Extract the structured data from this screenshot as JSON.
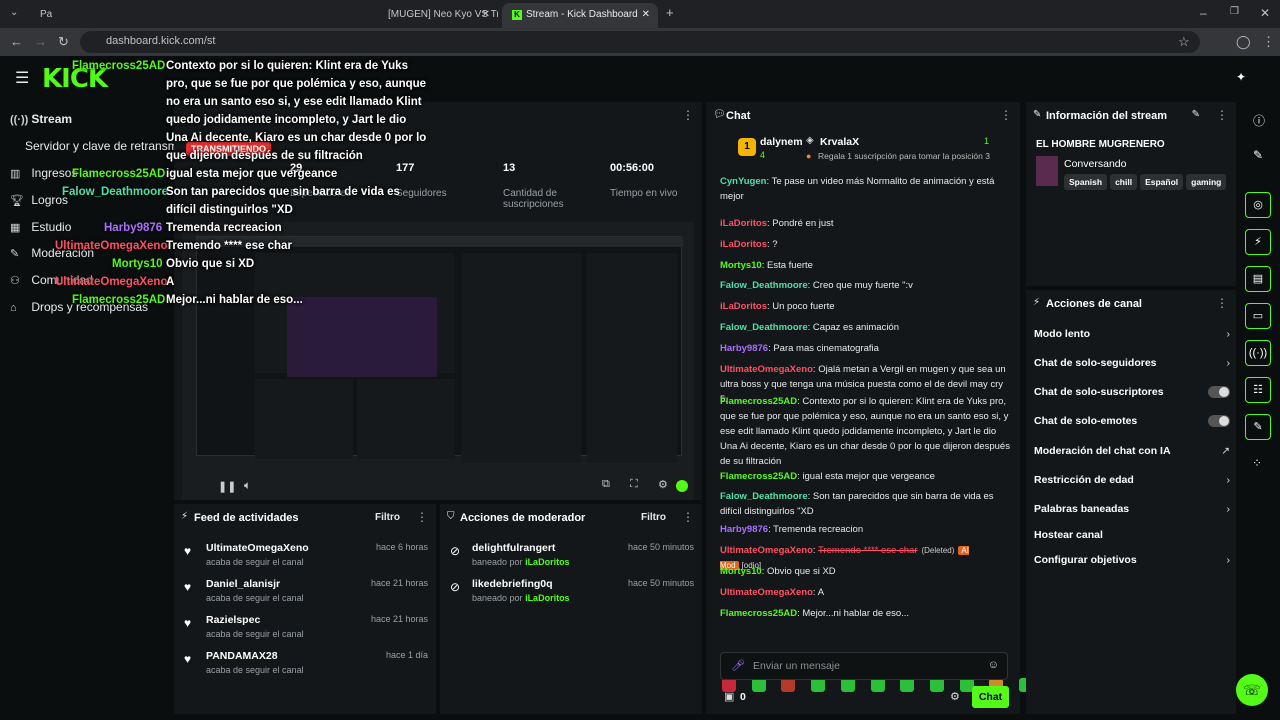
{
  "browser": {
    "tabs": [
      {
        "label": "Pa"
      },
      {
        "label": "[MUGEN] Neo Kyo VS Tru"
      },
      {
        "label": "Stream - Kick Dashboard"
      }
    ],
    "url": "dashboard.kick.com/st"
  },
  "sidebar": {
    "items": [
      {
        "label": "Stream",
        "icon": "stream-icon"
      },
      {
        "label": "Servidor y clave de retransm",
        "icon": ""
      },
      {
        "label": "Ingresos",
        "icon": "chart-icon"
      },
      {
        "label": "Logros",
        "icon": "trophy-icon"
      },
      {
        "label": "Estudio",
        "icon": "studio-icon"
      },
      {
        "label": "Moderación",
        "icon": "wrench-icon"
      },
      {
        "label": "Comunidad",
        "icon": "people-icon"
      },
      {
        "label": "Drops y recompensas",
        "icon": "gift-icon"
      }
    ]
  },
  "overlay": {
    "lines": [
      {
        "user": "UltimateOmegaXeno",
        "color": "#ff4f64",
        "text": "Ojalá metan a Vergil en mugen y que sea un"
      },
      {
        "user": "",
        "color": "",
        "text": "ultra boss y que tenga una música puesta"
      },
      {
        "user": "",
        "color": "",
        "text": "como el de devil may cry 5."
      },
      {
        "user": "Flamecross25AD",
        "color": "#53fc18",
        "text": "Contexto por si lo quieren: Klint era de Yuks"
      },
      {
        "user": "",
        "color": "",
        "text": "pro, que se fue por que polémica y eso, aunque"
      },
      {
        "user": "",
        "color": "",
        "text": "no era un santo eso si, y ese edit llamado Klint"
      },
      {
        "user": "",
        "color": "",
        "text": "quedo jodidamente incompleto, y Jart le dio"
      },
      {
        "user": "",
        "color": "",
        "text": "Una Ai decente, Kiaro es un char desde 0 por lo"
      },
      {
        "user": "",
        "color": "",
        "text": "que dijeron después de su filtración"
      },
      {
        "user": "Flamecross25AD",
        "color": "#53fc18",
        "text": "igual esta mejor que vergeance"
      },
      {
        "user": "Falow_Deathmoore",
        "color": "#4de1a8",
        "text": "Son tan parecidos que sin barra de vida es"
      },
      {
        "user": "",
        "color": "",
        "text": "difícil distinguirlos \"XD"
      },
      {
        "user": "Harby9876",
        "color": "#a970ff",
        "text": "Tremenda recreacion"
      },
      {
        "user": "UltimateOmegaXeno",
        "color": "#ff4f64",
        "text": "Tremendo **** ese char"
      },
      {
        "user": "Mortys10",
        "color": "#53fc18",
        "text": "Obvio que si XD"
      },
      {
        "user": "UltimateOmegaXeno",
        "color": "#ff4f64",
        "text": "A"
      },
      {
        "user": "Flamecross25AD",
        "color": "#53fc18",
        "text": "Mejor...ni hablar de eso..."
      }
    ],
    "badge_live": "TRANSMITIENDO",
    "info_label": "Información del stream"
  },
  "stream": {
    "stats": [
      {
        "value": "29",
        "label": "Espectadores"
      },
      {
        "value": "177",
        "label": "Seguidores"
      },
      {
        "value": "13",
        "label": "Cantidad de suscripciones"
      },
      {
        "value": "00:56:00",
        "label": "Tiempo en vivo"
      }
    ]
  },
  "activity": {
    "title": "Feed de actividades",
    "filter": "Filtro",
    "items": [
      {
        "name": "UltimateOmegaXeno",
        "sub": "acaba de seguir el canal",
        "time": "hace 6 horas"
      },
      {
        "name": "Daniel_alanisjr",
        "sub": "acaba de seguir el canal",
        "time": "hace 21 horas"
      },
      {
        "name": "Razielspec",
        "sub": "acaba de seguir el canal",
        "time": "hace 21 horas"
      },
      {
        "name": "PANDAMAX28",
        "sub": "acaba de seguir el canal",
        "time": "hace 1 día"
      }
    ]
  },
  "modactions": {
    "title": "Acciones de moderador",
    "filter": "Filtro",
    "items": [
      {
        "name": "delightfulrangert",
        "sub": "baneado por",
        "by": "iLaDoritos",
        "time": "hace 50 minutos"
      },
      {
        "name": "likedebriefing0q",
        "sub": "baneado por",
        "by": "iLaDoritos",
        "time": "hace 50 minutos"
      }
    ]
  },
  "chat": {
    "title": "Chat",
    "pinned": {
      "user1": "dalynem",
      "count1": "4",
      "user2": "KrvalaX",
      "count2": "1",
      "gift_text": "Regala 1 suscripción para tomar la posición 3"
    },
    "messages": [
      {
        "user": "CynYugen",
        "color": "#4de1a8",
        "text": "Te pase un video más Normalito de animación y está mejor"
      },
      {
        "user": "iLaDoritos",
        "color": "#ff4f64",
        "text": "Pondré en just"
      },
      {
        "user": "iLaDoritos",
        "color": "#ff4f64",
        "text": "?"
      },
      {
        "user": "Mortys10",
        "color": "#53fc18",
        "text": "Esta fuerte"
      },
      {
        "user": "Falow_Deathmoore",
        "color": "#4de1a8",
        "text": "Creo que muy fuerte \":v"
      },
      {
        "user": "iLaDoritos",
        "color": "#ff4f64",
        "text": "Un poco fuerte"
      },
      {
        "user": "Falow_Deathmoore",
        "color": "#4de1a8",
        "text": "Capaz es animación"
      },
      {
        "user": "Harby9876",
        "color": "#a970ff",
        "text": "Para mas cinematografia"
      },
      {
        "user": "UltimateOmegaXeno",
        "color": "#ff4f64",
        "text": "Ojalá metan a Vergil en mugen y que sea un ultra boss y que tenga una música puesta como el de devil may cry 5."
      },
      {
        "user": "Flamecross25AD",
        "color": "#53fc18",
        "text": "Contexto por si lo quieren: Klint era de Yuks pro, que se fue por que polémica y eso, aunque no era un santo eso si, y ese edit llamado Klint quedo jodidamente incompleto, y Jart le dio Una Ai decente, Kiaro es un char desde 0 por lo que dijeron después de su filtración"
      },
      {
        "user": "Flamecross25AD",
        "color": "#53fc18",
        "text": "igual esta mejor que vergeance"
      },
      {
        "user": "Falow_Deathmoore",
        "color": "#4de1a8",
        "text": "Son tan parecidos que sin barra de vida es difícil distinguirlos \"XD"
      },
      {
        "user": "Harby9876",
        "color": "#a970ff",
        "text": "Tremenda recreacion"
      },
      {
        "user": "UltimateOmegaXeno",
        "color": "#ff4f64",
        "text": "Tremendo **** ese char"
      },
      {
        "user": "Mortys10",
        "color": "#53fc18",
        "text": "Obvio que si XD"
      },
      {
        "user": "UltimateOmegaXeno",
        "color": "#ff4f64",
        "text": "A"
      },
      {
        "user": "Flamecross25AD",
        "color": "#53fc18",
        "text": "Mejor...ni hablar de eso..."
      }
    ],
    "deleted_label": "(Deleted)",
    "aimod_label": "AI Mod",
    "odio_label": "[odio]",
    "input_placeholder": "Enviar un mensaje",
    "points": "0",
    "send_label": "Chat"
  },
  "stream_info": {
    "title": "Información del stream",
    "stream_title": "EL HOMBRE MUGRENERO",
    "category": "Conversando",
    "tags": [
      "Spanish",
      "chill",
      "Español",
      "gaming"
    ]
  },
  "channel_actions": {
    "title": "Acciones de canal",
    "items": [
      {
        "label": "Modo lento",
        "control": "chevron"
      },
      {
        "label": "Chat de solo-seguidores",
        "control": "chevron"
      },
      {
        "label": "Chat de solo-suscriptores",
        "control": "toggle"
      },
      {
        "label": "Chat de solo-emotes",
        "control": "toggle"
      },
      {
        "label": "Moderación del chat con IA",
        "control": "external"
      },
      {
        "label": "Restricción de edad",
        "control": "chevron"
      },
      {
        "label": "Palabras baneadas",
        "control": "chevron"
      },
      {
        "label": "Hostear canal",
        "control": "none"
      },
      {
        "label": "Configurar objetivos",
        "control": "chevron"
      }
    ]
  },
  "colors": {
    "accent": "#53fc18",
    "bg": "#0b0e0f",
    "panel": "#141719"
  }
}
